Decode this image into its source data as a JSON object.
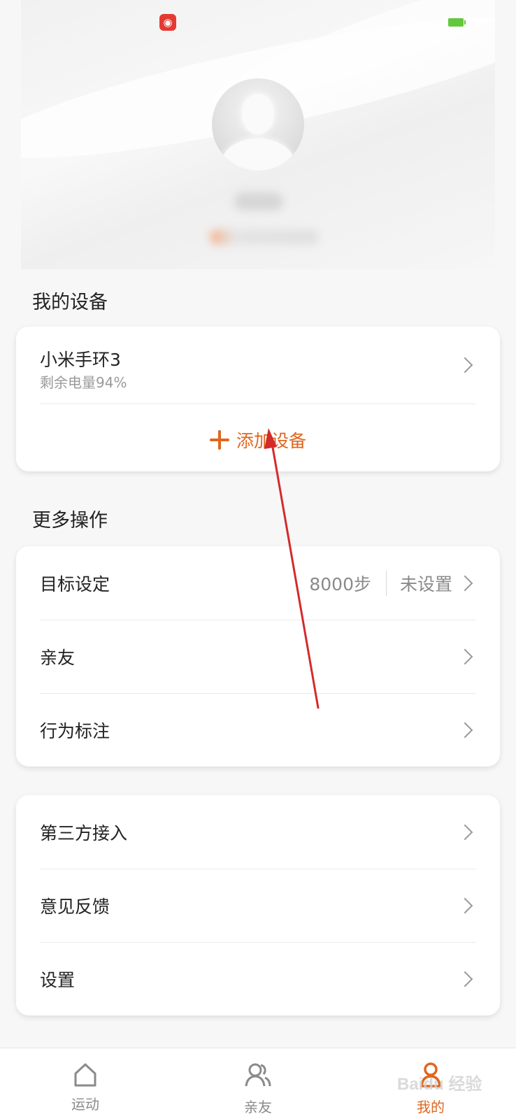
{
  "status_bar": {
    "app_icon_glyph": "◉"
  },
  "my_devices": {
    "title": "我的设备",
    "device": {
      "name": "小米手环3",
      "battery_text": "剩余电量94%"
    },
    "add_device_label": "添加设备"
  },
  "more_actions": {
    "title": "更多操作",
    "goal": {
      "label": "目标设定",
      "steps": "8000步",
      "status": "未设置"
    },
    "friends_label": "亲友",
    "behavior_label": "行为标注"
  },
  "misc": {
    "third_party_label": "第三方接入",
    "feedback_label": "意见反馈",
    "settings_label": "设置"
  },
  "bottom_nav": {
    "items": [
      {
        "label": "运动",
        "icon": "home-icon"
      },
      {
        "label": "亲友",
        "icon": "friends-icon"
      },
      {
        "label": "我的",
        "icon": "profile-icon",
        "active": true
      }
    ]
  },
  "watermark": "Baidu 经验",
  "colors": {
    "accent": "#e0661f",
    "battery": "#64c83c",
    "annotation_arrow": "#d42a2a"
  }
}
